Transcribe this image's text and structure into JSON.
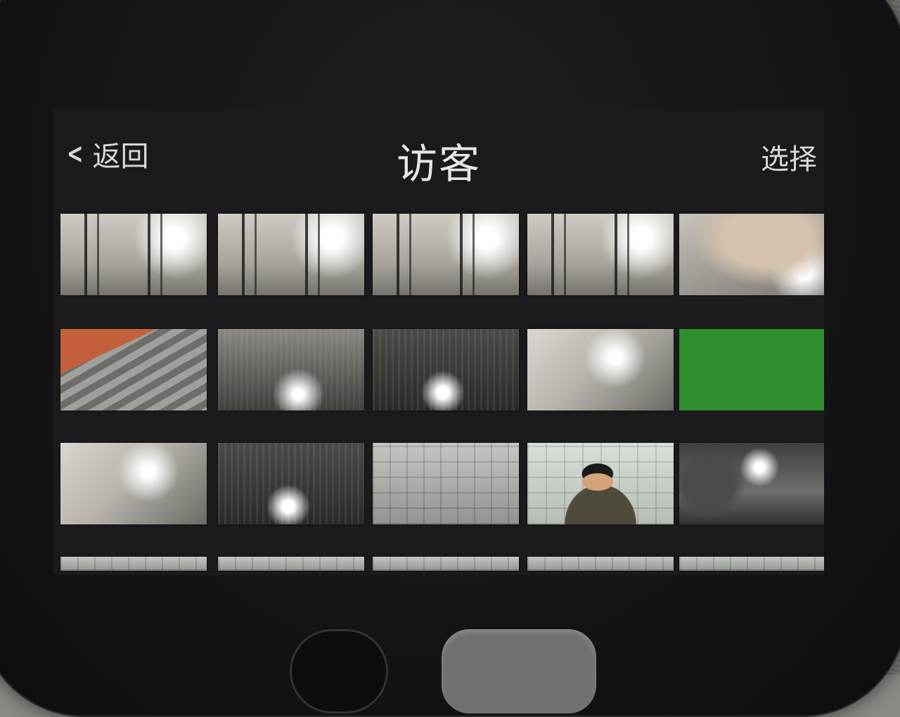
{
  "header": {
    "back_label": "返回",
    "title": "访客",
    "select_label": "选择"
  },
  "icons": {
    "back": "chevron-left-icon"
  },
  "thumbnails": [
    {
      "style": "t-wires"
    },
    {
      "style": "t-wires"
    },
    {
      "style": "t-wires"
    },
    {
      "style": "t-wires"
    },
    {
      "style": "t-hand"
    },
    {
      "style": "t-pipe"
    },
    {
      "style": "t-dim"
    },
    {
      "style": "t-dark"
    },
    {
      "style": "t-gray"
    },
    {
      "style": "t-green"
    },
    {
      "style": "t-gray"
    },
    {
      "style": "t-dark"
    },
    {
      "style": "t-floor"
    },
    {
      "style": "t-face"
    },
    {
      "style": "t-room"
    },
    {
      "style": "t-floor"
    },
    {
      "style": "t-floor"
    },
    {
      "style": "t-floor"
    },
    {
      "style": "t-floor"
    },
    {
      "style": "t-floor"
    }
  ],
  "colors": {
    "screen_bg": "#1b1b1d",
    "text": "#d8d8d8",
    "green_thumb": "#2f8f2f"
  }
}
